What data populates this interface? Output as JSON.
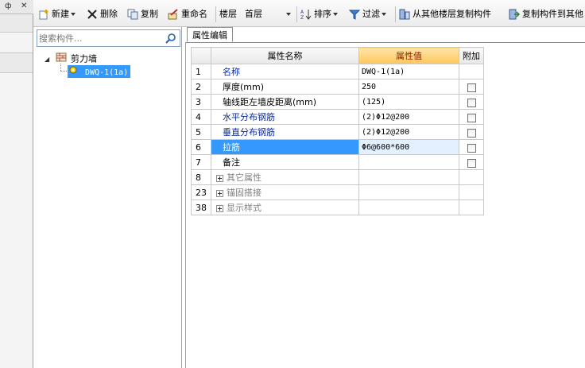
{
  "left_strip": {
    "pin": "ф",
    "close": "✕"
  },
  "toolbar": {
    "new_label": "新建",
    "delete_label": "删除",
    "copy_label": "复制",
    "rename_label": "重命名",
    "floor_label": "楼层",
    "floor_value": "首层",
    "sort_label": "排序",
    "filter_label": "过滤",
    "copy_from_floor_label": "从其他楼层复制构件",
    "copy_to_floor_label": "复制构件到其他"
  },
  "search": {
    "placeholder": "搜索构件..."
  },
  "tree": {
    "root_label": "剪力墙",
    "child_label": "DWQ-1(1a)"
  },
  "tab": {
    "label": "属性编辑"
  },
  "grid": {
    "headers": {
      "num": "",
      "name": "属性名称",
      "value": "属性值",
      "extra": "附加"
    },
    "rows": [
      {
        "num": "1",
        "name": "名称",
        "value": "DWQ-1(1a)"
      },
      {
        "num": "2",
        "name": "厚度(mm)",
        "value": "250"
      },
      {
        "num": "3",
        "name": "轴线距左墙皮距离(mm)",
        "value": "(125)"
      },
      {
        "num": "4",
        "name": "水平分布钢筋",
        "value": "(2)Φ12@200"
      },
      {
        "num": "5",
        "name": "垂直分布钢筋",
        "value": "(2)Φ12@200"
      },
      {
        "num": "6",
        "name": "拉筋",
        "value": "Φ6@600*600"
      },
      {
        "num": "7",
        "name": "备注",
        "value": ""
      },
      {
        "num": "8",
        "name": "其它属性",
        "value": ""
      },
      {
        "num": "23",
        "name": "锚固搭接",
        "value": ""
      },
      {
        "num": "38",
        "name": "显示样式",
        "value": ""
      }
    ]
  },
  "colors": {
    "selection": "#3399ff",
    "header_highlight": "#ffc65a",
    "link_blue": "#0a2aa0"
  }
}
